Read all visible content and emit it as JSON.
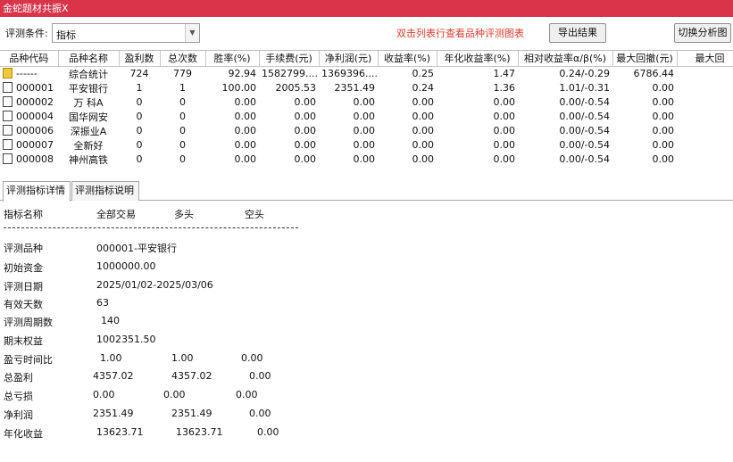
{
  "window": {
    "title": "金蛇题材共振X"
  },
  "toolbar": {
    "criteria_label": "评测条件:",
    "criteria_value": "指标",
    "hint": "双击列表行查看品种评测图表",
    "export_button": "导出结果",
    "switch_button": "切换分析图"
  },
  "grid": {
    "columns": [
      "品种代码",
      "品种名称",
      "盈利数",
      "总次数",
      "胜率(%)",
      "手续费(元)",
      "净利润(元)",
      "收益率(%)",
      "年化收益率(%)",
      "相对收益率α/β(%)",
      "最大回撤(元)",
      "最大回"
    ],
    "rows": [
      {
        "code": "------",
        "name": "综合统计",
        "wins": "724",
        "total": "779",
        "winrate": "92.94",
        "fee": "1582799....",
        "profit": "1369396....",
        "ret": "0.25",
        "annual": "1.47",
        "alpha": "0.24/-0.29",
        "maxdd": "6786.44",
        "icon": "folder"
      },
      {
        "code": "000001",
        "name": "平安银行",
        "wins": "1",
        "total": "1",
        "winrate": "100.00",
        "fee": "2005.53",
        "profit": "2351.49",
        "ret": "0.24",
        "annual": "1.36",
        "alpha": "1.01/-0.31",
        "maxdd": "0.00",
        "icon": "doc"
      },
      {
        "code": "000002",
        "name": "万 科A",
        "wins": "0",
        "total": "0",
        "winrate": "0.00",
        "fee": "0.00",
        "profit": "0.00",
        "ret": "0.00",
        "annual": "0.00",
        "alpha": "0.00/-0.54",
        "maxdd": "0.00",
        "icon": "doc"
      },
      {
        "code": "000004",
        "name": "国华网安",
        "wins": "0",
        "total": "0",
        "winrate": "0.00",
        "fee": "0.00",
        "profit": "0.00",
        "ret": "0.00",
        "annual": "0.00",
        "alpha": "0.00/-0.54",
        "maxdd": "0.00",
        "icon": "doc"
      },
      {
        "code": "000006",
        "name": "深振业A",
        "wins": "0",
        "total": "0",
        "winrate": "0.00",
        "fee": "0.00",
        "profit": "0.00",
        "ret": "0.00",
        "annual": "0.00",
        "alpha": "0.00/-0.54",
        "maxdd": "0.00",
        "icon": "doc"
      },
      {
        "code": "000007",
        "name": "全新好",
        "wins": "0",
        "total": "0",
        "winrate": "0.00",
        "fee": "0.00",
        "profit": "0.00",
        "ret": "0.00",
        "annual": "0.00",
        "alpha": "0.00/-0.54",
        "maxdd": "0.00",
        "icon": "doc"
      },
      {
        "code": "000008",
        "name": "神州高铁",
        "wins": "0",
        "total": "0",
        "winrate": "0.00",
        "fee": "0.00",
        "profit": "0.00",
        "ret": "0.00",
        "annual": "0.00",
        "alpha": "0.00/-0.54",
        "maxdd": "0.00",
        "icon": "doc"
      }
    ]
  },
  "tabs": [
    "评测指标详情",
    "评测指标说明"
  ],
  "detail": {
    "header": [
      "指标名称",
      "全部交易",
      "多头",
      "空头"
    ],
    "items": [
      {
        "name": "评测品种",
        "all": "000001-平安银行",
        "long": "",
        "short": ""
      },
      {
        "name": "初始资金",
        "all": "1000000.00",
        "long": "",
        "short": ""
      },
      {
        "name": "评测日期",
        "all": "2025/01/02-2025/03/06",
        "long": "",
        "short": ""
      },
      {
        "name": "有效天数",
        "all": "63",
        "long": "",
        "short": ""
      },
      {
        "name": "评测周期数",
        "all": "140",
        "long": "",
        "short": ""
      },
      {
        "name": "期末权益",
        "all": "1002351.50",
        "long": "",
        "short": ""
      },
      {
        "name": "盈亏时间比",
        "all": "1.00",
        "long": "1.00",
        "short": "0.00"
      },
      {
        "name": "总盈利",
        "all": "4357.02",
        "long": "4357.02",
        "short": "0.00"
      },
      {
        "name": "总亏损",
        "all": "0.00",
        "long": "0.00",
        "short": "0.00"
      },
      {
        "name": "净利润",
        "all": "2351.49",
        "long": "2351.49",
        "short": "0.00"
      },
      {
        "name": "年化收益",
        "all": "13623.71",
        "long": "13623.71",
        "short": "0.00"
      }
    ]
  }
}
